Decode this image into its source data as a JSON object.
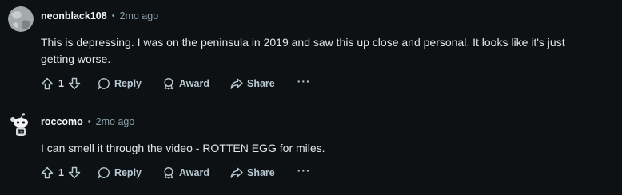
{
  "comments": [
    {
      "username": "neonblack108",
      "separator": "•",
      "time": "2mo ago",
      "avatar_icon": "grey-user-avatar-icon",
      "body": "This is depressing. I was on the peninsula in 2019 and saw this up close and personal.  It looks like it's just getting worse.",
      "score": "1",
      "reply_label": "Reply",
      "award_label": "Award",
      "share_label": "Share",
      "more_label": "···"
    },
    {
      "username": "roccomo",
      "separator": "•",
      "time": "2mo ago",
      "avatar_icon": "snoo-avatar-icon",
      "body": "I can smell it through the video - ROTTEN EGG for miles.",
      "score": "1",
      "reply_label": "Reply",
      "award_label": "Award",
      "share_label": "Share",
      "more_label": "···"
    }
  ],
  "colors": {
    "background": "#0e1113",
    "text": "#e3e6e8",
    "muted": "#8ba2ad",
    "action": "#b7cad4"
  }
}
